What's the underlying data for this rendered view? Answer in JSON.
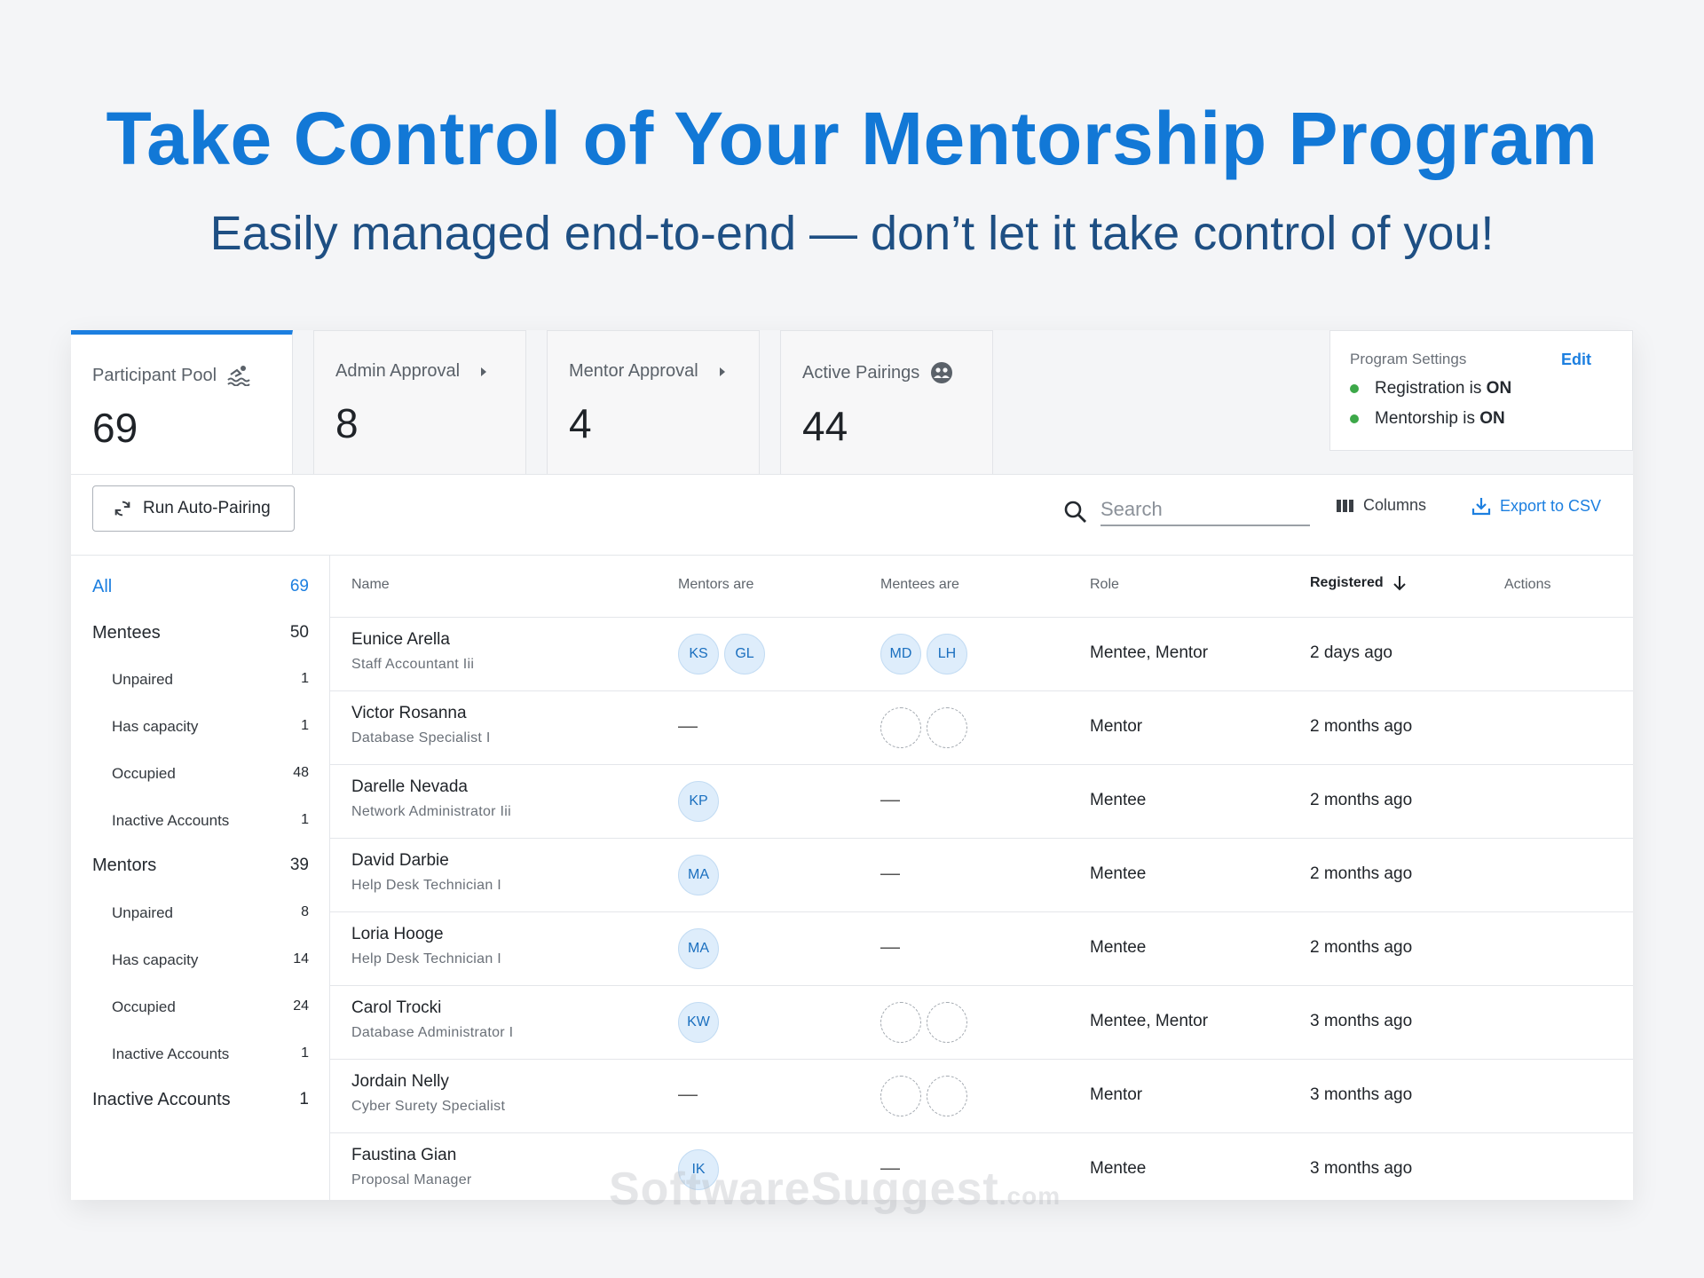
{
  "hero": {
    "title": "Take Control of Your Mentorship Program",
    "subtitle": "Easily managed end-to-end — don’t let it take control of you!"
  },
  "tabs": [
    {
      "label": "Participant Pool",
      "value": "69",
      "icon": "swimmer-icon"
    },
    {
      "label": "Admin Approval",
      "value": "8",
      "icon": "triangle-right-icon"
    },
    {
      "label": "Mentor Approval",
      "value": "4",
      "icon": "triangle-right-icon"
    },
    {
      "label": "Active Pairings",
      "value": "44",
      "icon": "group-icon"
    }
  ],
  "settings": {
    "title": "Program Settings",
    "edit": "Edit",
    "rows": [
      {
        "prefix": "Registration is ",
        "state": "ON"
      },
      {
        "prefix": "Mentorship is ",
        "state": "ON"
      }
    ]
  },
  "toolbar": {
    "auto_pairing": "Run Auto-Pairing",
    "search_placeholder": "Search",
    "columns": "Columns",
    "export": "Export to CSV"
  },
  "sidebar": [
    {
      "label": "All",
      "count": "69"
    },
    {
      "label": "Mentees",
      "count": "50"
    },
    {
      "label": "Unpaired",
      "count": "1"
    },
    {
      "label": "Has capacity",
      "count": "1"
    },
    {
      "label": "Occupied",
      "count": "48"
    },
    {
      "label": "Inactive Accounts",
      "count": "1"
    },
    {
      "label": "Mentors",
      "count": "39"
    },
    {
      "label": "Unpaired",
      "count": "8"
    },
    {
      "label": "Has capacity",
      "count": "14"
    },
    {
      "label": "Occupied",
      "count": "24"
    },
    {
      "label": "Inactive Accounts",
      "count": "1"
    },
    {
      "label": "Inactive Accounts",
      "count": "1"
    }
  ],
  "table": {
    "headers": [
      "Name",
      "Mentors are",
      "Mentees are",
      "Role",
      "Registered",
      "Actions"
    ],
    "rows": [
      {
        "name": "Eunice Arella",
        "title": "Staff Accountant Iii",
        "mentors": [
          "KS",
          "GL"
        ],
        "mentees": [
          "MD",
          "LH"
        ],
        "role": "Mentee, Mentor",
        "registered": "2 days ago"
      },
      {
        "name": "Victor Rosanna",
        "title": "Database Specialist I",
        "mentors_dash": "—",
        "role": "Mentor",
        "registered": "2 months ago"
      },
      {
        "name": "Darelle Nevada",
        "title": "Network Administrator Iii",
        "mentors": [
          "KP"
        ],
        "mentees_dash": "—",
        "role": "Mentee",
        "registered": "2 months ago"
      },
      {
        "name": "David Darbie",
        "title": "Help Desk Technician I",
        "mentors": [
          "MA"
        ],
        "mentees_dash": "—",
        "role": "Mentee",
        "registered": "2 months ago"
      },
      {
        "name": "Loria Hooge",
        "title": "Help Desk Technician I",
        "mentors": [
          "MA"
        ],
        "mentees_dash": "—",
        "role": "Mentee",
        "registered": "2 months ago"
      },
      {
        "name": "Carol Trocki",
        "title": "Database Administrator I",
        "mentors": [
          "KW"
        ],
        "role": "Mentee, Mentor",
        "registered": "3 months ago"
      },
      {
        "name": "Jordain Nelly",
        "title": "Cyber Surety Specialist",
        "mentors_dash": "—",
        "role": "Mentor",
        "registered": "3 months ago"
      },
      {
        "name": "Faustina Gian",
        "title": "Proposal Manager",
        "mentors": [
          "IK"
        ],
        "mentees_dash": "—",
        "role": "Mentee",
        "registered": "3 months ago"
      }
    ]
  },
  "watermark": {
    "main": "SoftwareSuggest",
    "suffix": ".com"
  },
  "colors": {
    "accent": "#1c7fe0",
    "title": "#1278d6",
    "subtitle": "#1e4f83",
    "status_on": "#3da849"
  }
}
